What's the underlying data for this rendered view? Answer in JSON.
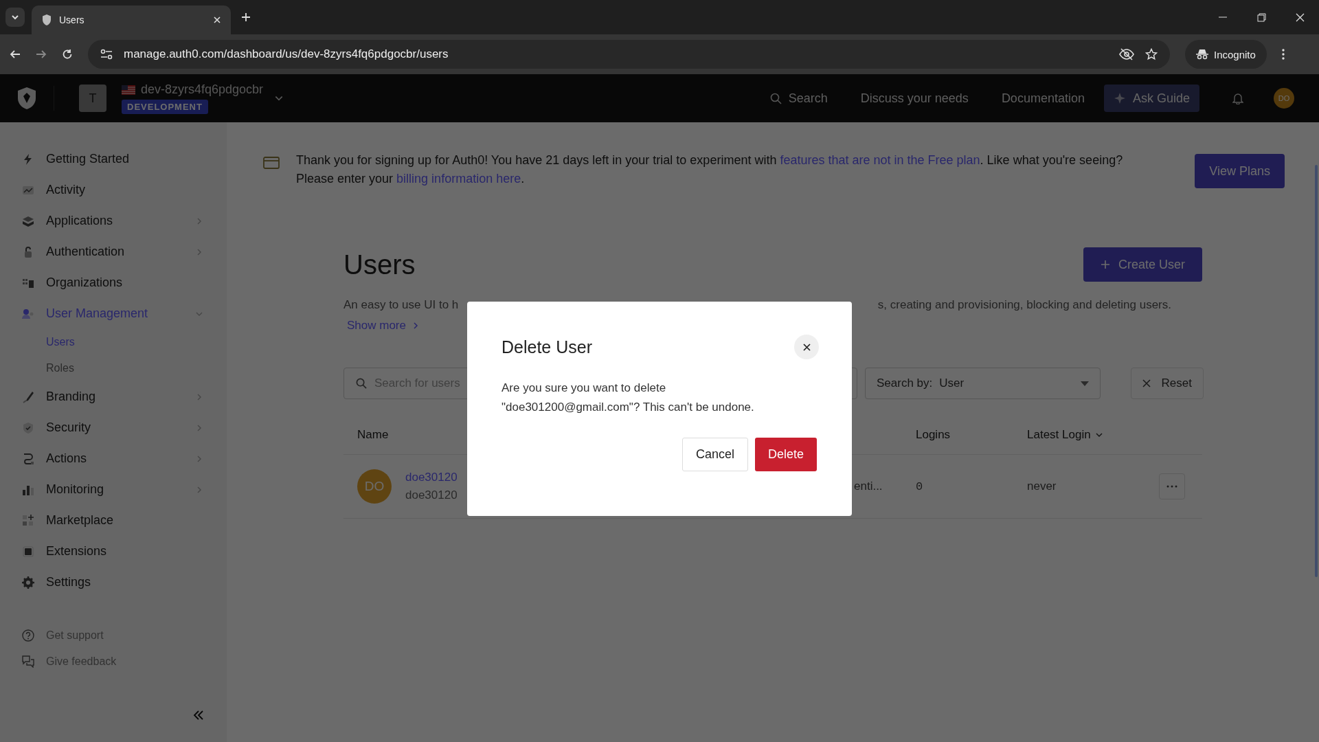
{
  "browser": {
    "tab_title": "Users",
    "url": "manage.auth0.com/dashboard/us/dev-8zyrs4fq6pdgocbr/users",
    "profile": "Incognito"
  },
  "header": {
    "tenant_initial": "T",
    "tenant_name": "dev-8zyrs4fq6pdgocbr",
    "environment": "DEVELOPMENT",
    "nav": [
      "Search",
      "Discuss your needs",
      "Documentation"
    ],
    "ask_guide": "Ask Guide",
    "avatar": "DO"
  },
  "sidebar": {
    "items": [
      {
        "label": "Getting Started",
        "selected": false
      },
      {
        "label": "Activity",
        "selected": false
      },
      {
        "label": "Applications",
        "expanded": false,
        "selected": false
      },
      {
        "label": "Authentication",
        "expanded": false,
        "selected": false
      },
      {
        "label": "Organizations",
        "selected": false
      },
      {
        "label": "User Management",
        "expanded": true,
        "selected": true,
        "children": [
          {
            "label": "Users",
            "selected": true
          },
          {
            "label": "Roles",
            "selected": false
          }
        ]
      },
      {
        "label": "Branding",
        "expanded": false,
        "selected": false
      },
      {
        "label": "Security",
        "expanded": false,
        "selected": false
      },
      {
        "label": "Actions",
        "expanded": false,
        "selected": false
      },
      {
        "label": "Monitoring",
        "expanded": false,
        "selected": false
      },
      {
        "label": "Marketplace",
        "selected": false
      },
      {
        "label": "Extensions",
        "selected": false
      },
      {
        "label": "Settings",
        "selected": false
      }
    ],
    "footer": [
      "Get support",
      "Give feedback"
    ]
  },
  "banner": {
    "parts": [
      {
        "text": "Thank you for signing up for Auth0! You have 21 days left in your trial to experiment with ",
        "kind": "text"
      },
      {
        "text": "features that are not in the Free plan",
        "kind": "link"
      },
      {
        "text": ". Like what you're seeing? Please enter your ",
        "kind": "text"
      },
      {
        "text": "billing information here",
        "kind": "link"
      },
      {
        "text": ".",
        "kind": "text"
      }
    ],
    "button": "View Plans"
  },
  "page": {
    "title": "Users",
    "create_button": "Create User",
    "description_left": "An easy to use UI to h",
    "description_right": "s, creating and provisioning, blocking and deleting users.",
    "show_more": "Show more",
    "search": {
      "placeholder": "Search for users"
    },
    "search_by": {
      "label": "Search by:",
      "value": "User"
    },
    "reset": "Reset",
    "table": {
      "columns": [
        {
          "label": "Name",
          "sorted": false
        },
        {
          "label": "Logins",
          "sorted": false
        },
        {
          "label": "Latest Login",
          "sorted": true
        }
      ],
      "rows": [
        {
          "avatar": "DO",
          "name": "doe30120",
          "email": "doe30120",
          "column_3": "enti...",
          "logins": "0",
          "latest_login": "never"
        }
      ]
    }
  },
  "dialog": {
    "title": "Delete User",
    "message": "Are you sure you want to delete \"doe301200@gmail.com\"? This can't be undone.",
    "cancel": "Cancel",
    "confirm": "Delete"
  }
}
